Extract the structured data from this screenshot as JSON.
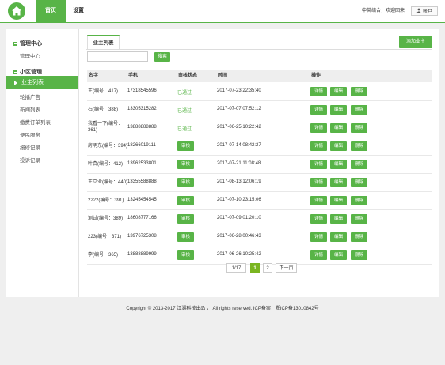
{
  "header": {
    "nav": [
      "首页",
      "设置"
    ],
    "welcome": "中英结合，欢迎回来",
    "account_label": "账户"
  },
  "sidebar": {
    "groups": [
      {
        "title": "管理中心",
        "items": [
          "管理中心"
        ]
      },
      {
        "title": "小区管理",
        "items": [
          "业主列表",
          "轮播广告",
          "新闻列表",
          "缴费订单列表",
          "便民服务",
          "报修记录",
          "投诉记录"
        ]
      }
    ],
    "active_item": "业主列表"
  },
  "main": {
    "tab_label": "业主列表",
    "add_button": "添加业主",
    "search_value": "",
    "search_placeholder": "",
    "search_button": "搜索",
    "columns": [
      "名字",
      "手机",
      "审核状态",
      "时间",
      "操作"
    ],
    "actions": [
      "详情",
      "编辑",
      "删除"
    ],
    "review_label": "审核",
    "rows": [
      {
        "name": "王(编号：417)",
        "phone": "17318545596",
        "status": "已通过",
        "approved": true,
        "time": "2017-07-23 22:35:40"
      },
      {
        "name": "石(编号：388)",
        "phone": "13305315282",
        "status": "已通过",
        "approved": true,
        "time": "2017-07-07 07:52:12"
      },
      {
        "name": "我看一下(编号：361)",
        "phone": "13888888888",
        "status": "已通过",
        "approved": true,
        "time": "2017-06-25 10:22:42"
      },
      {
        "name": "房明东(编号：394)",
        "phone": "18266019111",
        "status": "审核",
        "approved": false,
        "time": "2017-07-14 08:42:27"
      },
      {
        "name": "叶森(编号：412)",
        "phone": "13962533801",
        "status": "审核",
        "approved": false,
        "time": "2017-07-21 11:08:48"
      },
      {
        "name": "王立业(编号：440)",
        "phone": "13355588888",
        "status": "审核",
        "approved": false,
        "time": "2017-08-13 12:06:19"
      },
      {
        "name": "2222(编号：391)",
        "phone": "13245454545",
        "status": "审核",
        "approved": false,
        "time": "2017-07-10 23:15:06"
      },
      {
        "name": "测试(编号：389)",
        "phone": "18608777166",
        "status": "审核",
        "approved": false,
        "time": "2017-07-09 01:20:10"
      },
      {
        "name": "223(编号：371)",
        "phone": "13976725308",
        "status": "审核",
        "approved": false,
        "time": "2017-06-28 00:46:43"
      },
      {
        "name": "李(编号：365)",
        "phone": "13888889999",
        "status": "审核",
        "approved": false,
        "time": "2017-06-26 10:25:42"
      }
    ]
  },
  "pagination": {
    "summary": "1/17",
    "pages": [
      "1",
      "2"
    ],
    "current": "1",
    "next": "下一页"
  },
  "footer": "Copyright © 2013-2017 江湖科技出品 ， All rights reserved. ICP备案：郑ICP备13010842号",
  "colors": {
    "accent": "#58b447",
    "page_bg": "#efefef"
  }
}
